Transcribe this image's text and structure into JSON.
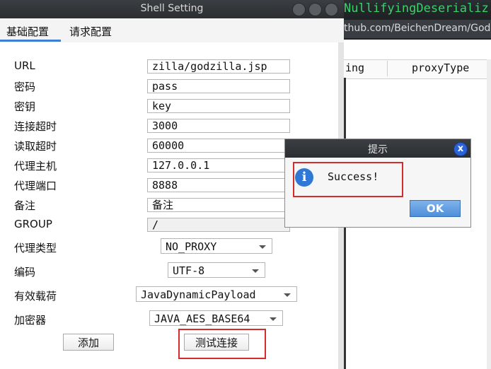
{
  "background_app": {
    "title_fragment": "NullifyingDeserializ",
    "url_fragment": "thub.com/BeichenDream/Godz",
    "table_columns": [
      "ing",
      "proxyType"
    ]
  },
  "window": {
    "title": "Shell Setting",
    "tabs": [
      {
        "label": "基础配置",
        "active": true
      },
      {
        "label": "请求配置",
        "active": false
      }
    ],
    "fields": [
      {
        "label": "URL",
        "value": "zilla/godzilla.jsp"
      },
      {
        "label": "密码",
        "value": "pass"
      },
      {
        "label": "密钥",
        "value": "key"
      },
      {
        "label": "连接超时",
        "value": "3000"
      },
      {
        "label": "读取超时",
        "value": "60000"
      },
      {
        "label": "代理主机",
        "value": "127.0.0.1"
      },
      {
        "label": "代理端口",
        "value": "8888"
      },
      {
        "label": "备注",
        "value": "备注"
      },
      {
        "label": "GROUP",
        "value": "/"
      }
    ],
    "selects": [
      {
        "label": "代理类型",
        "value": "NO_PROXY"
      },
      {
        "label": "编码",
        "value": "UTF-8"
      },
      {
        "label": "有效载荷",
        "value": "JavaDynamicPayload"
      },
      {
        "label": "加密器",
        "value": "JAVA_AES_BASE64"
      }
    ],
    "buttons": {
      "add": "添加",
      "test": "测试连接"
    }
  },
  "dialog": {
    "title": "提示",
    "message": "Success!",
    "ok": "OK",
    "close_symbol": "x",
    "info_symbol": "i"
  },
  "colors": {
    "highlight": "#d62b2b",
    "accent": "#3d7fd2",
    "terminal_green": "#38d26a"
  }
}
